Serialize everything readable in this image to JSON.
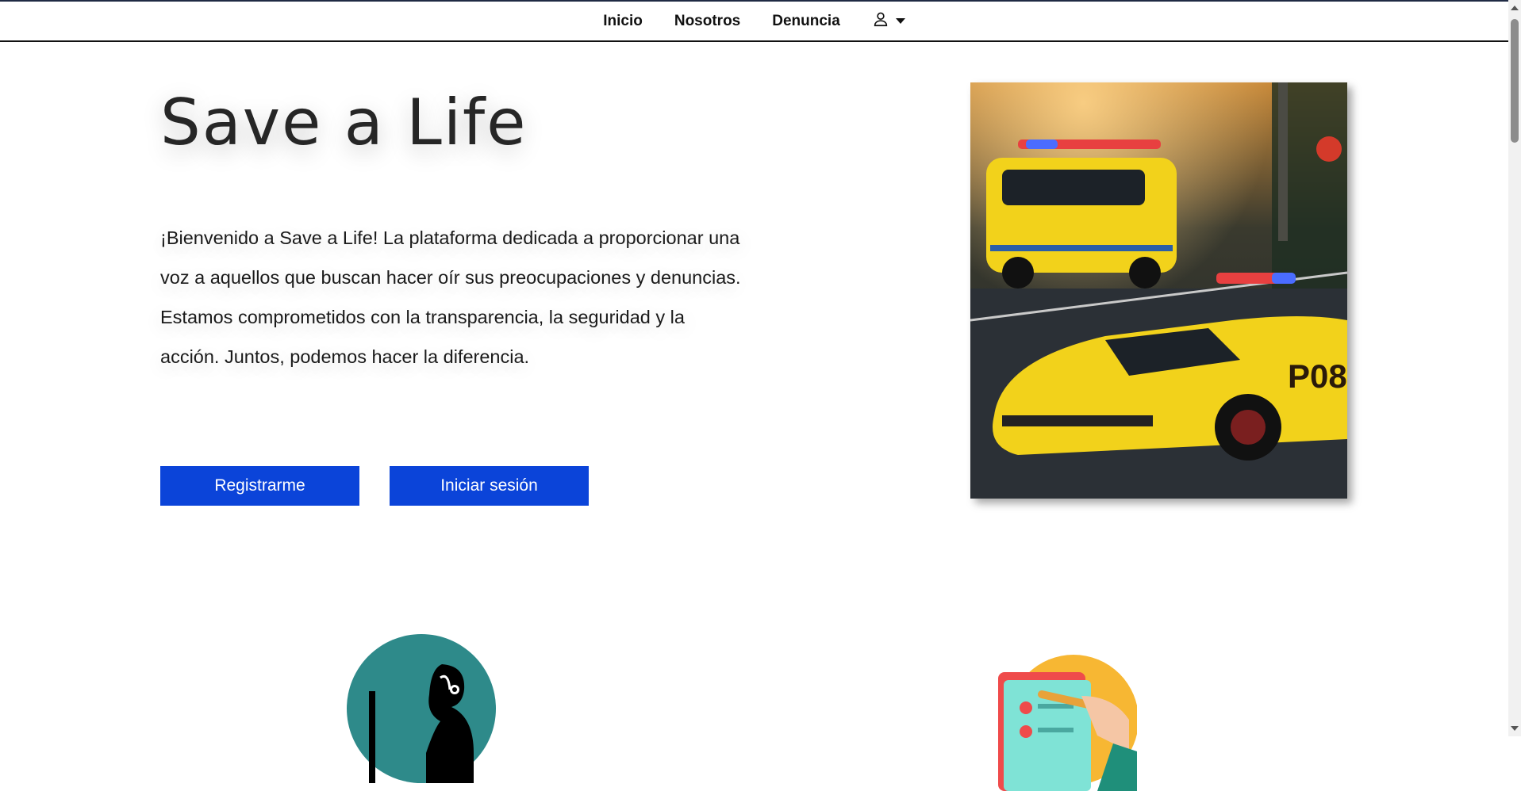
{
  "nav": {
    "items": [
      {
        "label": "Inicio"
      },
      {
        "label": "Nosotros"
      },
      {
        "label": "Denuncia"
      }
    ],
    "user_icon": "user-icon",
    "dropdown_icon": "caret-down-icon"
  },
  "hero": {
    "title": "Save a Life",
    "text": "¡Bienvenido a Save a Life! La plataforma dedicada a proporcionar una voz a aquellos que buscan hacer oír sus preocupaciones y denuncias. Estamos comprometidos con la transparencia, la seguridad y la acción. Juntos, podemos hacer la diferencia.",
    "register_label": "Registrarme",
    "login_label": "Iniciar sesión",
    "image": "police-cars-illustration"
  },
  "features": [
    {
      "icon": "call-center-agent-icon"
    },
    {
      "icon": "checklist-report-icon"
    }
  ],
  "colors": {
    "button": "#0b44d9",
    "text": "#1a1a1a",
    "icon_teal": "#2e8a8a",
    "icon_orange": "#f7b733"
  }
}
